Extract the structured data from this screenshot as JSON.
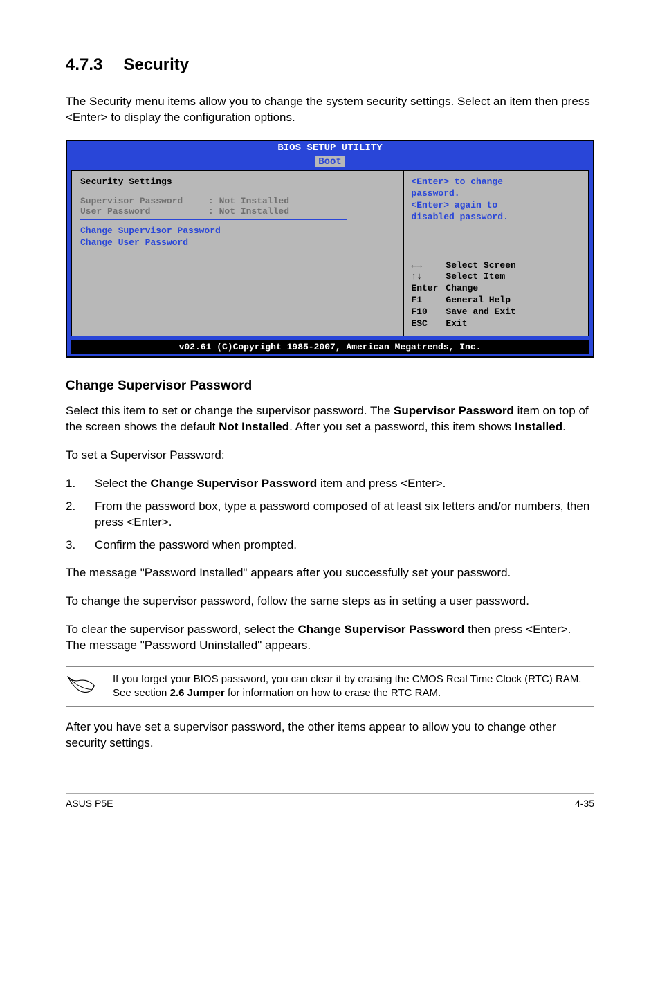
{
  "heading": {
    "num": "4.7.3",
    "title": "Security"
  },
  "intro": "The Security menu items allow you to change the system security settings. Select an item then press <Enter> to display the configuration options.",
  "bios": {
    "header": "BIOS SETUP UTILITY",
    "tab": "Boot",
    "section_title": "Security Settings",
    "rows": [
      {
        "label": "Supervisor Password",
        "value": ": Not Installed"
      },
      {
        "label": "User Password",
        "value": ": Not Installed"
      }
    ],
    "blue_items": [
      "Change Supervisor Password",
      "Change User Password"
    ],
    "help_top_lines": [
      {
        "pre": "",
        "tag": "<Enter>",
        "post": " to change"
      },
      {
        "pre": "password.",
        "tag": "",
        "post": ""
      },
      {
        "pre": "",
        "tag": "<Enter>",
        "post": " again to"
      },
      {
        "pre": "disabled password.",
        "tag": "",
        "post": ""
      }
    ],
    "nav": [
      {
        "key": "←→",
        "label": "Select Screen"
      },
      {
        "key": "↑↓",
        "label": "Select Item"
      },
      {
        "key": "Enter",
        "label": "Change"
      },
      {
        "key": "F1",
        "label": "General Help"
      },
      {
        "key": "F10",
        "label": "Save and Exit"
      },
      {
        "key": "ESC",
        "label": "Exit"
      }
    ],
    "footer": "v02.61 (C)Copyright 1985-2007, American Megatrends, Inc."
  },
  "subheading": "Change Supervisor Password",
  "p1_pre": "Select this item to set or change the supervisor password. The ",
  "p1_b1": "Supervisor Password",
  "p1_mid": " item on top of the screen shows the default ",
  "p1_b2": "Not Installed",
  "p1_mid2": ". After you set a password, this item shows ",
  "p1_b3": "Installed",
  "p1_end": ".",
  "p2": "To set a Supervisor Password:",
  "steps": {
    "s1_pre": "Select the ",
    "s1_b": "Change Supervisor Password",
    "s1_post": " item and press <Enter>.",
    "s2": "From the password box, type a password composed of at least six letters and/or numbers, then press <Enter>.",
    "s3": "Confirm the password when prompted."
  },
  "p3": "The message \"Password Installed\" appears after you successfully set your password.",
  "p4": "To change the supervisor password, follow the same steps as in setting a user password.",
  "p5_pre": "To clear the supervisor password, select the ",
  "p5_b": "Change Supervisor Password",
  "p5_post": " then press <Enter>. The message \"Password Uninstalled\" appears.",
  "note_pre": "If you forget your BIOS password, you can clear it by erasing the CMOS Real Time Clock (RTC) RAM. See section ",
  "note_b": "2.6 Jumper",
  "note_post": " for information on how to erase the RTC RAM.",
  "p6": "After you have set a supervisor password, the other items appear to allow you to change other security settings.",
  "footer": {
    "left": "ASUS P5E",
    "right": "4-35"
  }
}
